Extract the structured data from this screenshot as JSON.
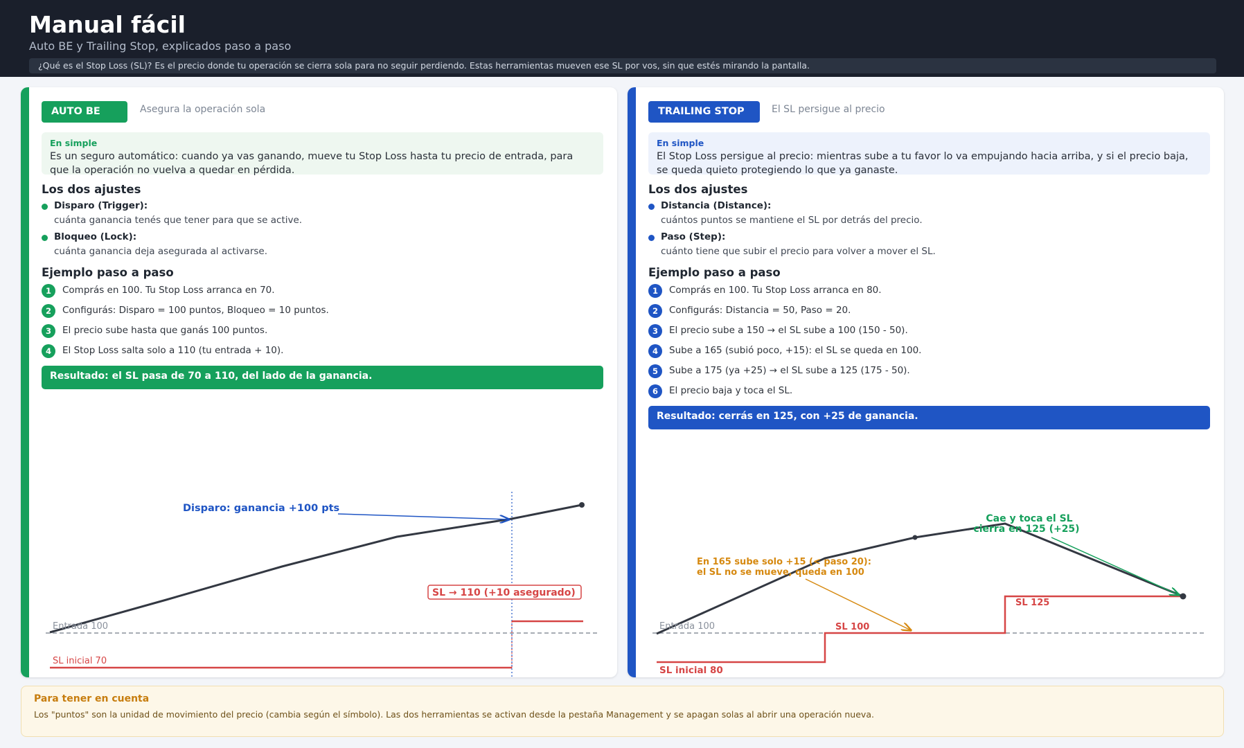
{
  "header": {
    "title": "Manual fácil",
    "subtitle": "Auto BE y Trailing Stop, explicados paso a paso",
    "note": "¿Qué es el Stop Loss (SL)?  Es el precio donde tu operación se cierra sola para no seguir perdiendo. Estas herramientas mueven ese SL por vos, sin que estés mirando la pantalla."
  },
  "colors": {
    "green": "#16a05c",
    "blue": "#1f55c4",
    "red": "#d64545",
    "orange": "#d68910",
    "dark": "#1a1f2b"
  },
  "auto_be": {
    "badge": "AUTO BE",
    "badge_sub": "Asegura la operación sola",
    "simple_label": "En simple",
    "simple_text": "Es un seguro automático: cuando ya vas ganando, mueve tu Stop Loss hasta tu precio de entrada, para que la operación no vuelva a quedar en pérdida.",
    "settings_title": "Los dos ajustes",
    "settings": [
      {
        "name": "Disparo (Trigger):",
        "desc": "cuánta ganancia tenés que tener para que se active."
      },
      {
        "name": "Bloqueo (Lock):",
        "desc": "cuánta ganancia deja asegurada al activarse."
      }
    ],
    "example_title": "Ejemplo paso a paso",
    "steps": [
      {
        "n": "1",
        "text": "Comprás en 100. Tu Stop Loss arranca en 70."
      },
      {
        "n": "2",
        "text": "Configurás: Disparo = 100 puntos, Bloqueo = 10 puntos."
      },
      {
        "n": "3",
        "text": "El precio sube hasta que ganás 100 puntos."
      },
      {
        "n": "4",
        "text": "El Stop Loss salta solo a 110 (tu entrada + 10)."
      }
    ],
    "result": "Resultado: el SL pasa de 70 a 110, del lado de la ganancia.",
    "chart": {
      "trigger_label": "Disparo: ganancia +100 pts",
      "sl_box_label": "SL → 110  (+10 asegurado)",
      "entry_label": "Entrada 100",
      "sl_initial_label": "SL inicial 70"
    }
  },
  "trailing": {
    "badge": "TRAILING STOP",
    "badge_sub": "El SL persigue al precio",
    "simple_label": "En simple",
    "simple_text": "El Stop Loss persigue al precio: mientras sube a tu favor lo va empujando hacia arriba, y si el precio baja, se queda quieto protegiendo lo que ya ganaste.",
    "settings_title": "Los dos ajustes",
    "settings": [
      {
        "name": "Distancia (Distance):",
        "desc": "cuántos puntos se mantiene el SL por detrás del precio."
      },
      {
        "name": "Paso (Step):",
        "desc": "cuánto tiene que subir el precio para volver a mover el SL."
      }
    ],
    "example_title": "Ejemplo paso a paso",
    "steps": [
      {
        "n": "1",
        "text": "Comprás en 100. Tu Stop Loss arranca en 80."
      },
      {
        "n": "2",
        "text": "Configurás: Distancia = 50, Paso = 20."
      },
      {
        "n": "3",
        "text": "El precio sube a 150 → el SL sube a 100 (150 - 50)."
      },
      {
        "n": "4",
        "text": "Sube a 165 (subió poco, +15): el SL se queda en 100."
      },
      {
        "n": "5",
        "text": "Sube a 175 (ya +25) → el SL sube a 125 (175 - 50)."
      },
      {
        "n": "6",
        "text": "El precio baja y toca el SL."
      }
    ],
    "result": "Resultado: cerrás en 125, con +25 de ganancia.",
    "chart": {
      "annot_165_line1": "En 165 sube solo +15 (< paso 20):",
      "annot_165_line2": "el SL no se mueve, queda en 100",
      "annot_hit_line1": "Cae y toca el SL",
      "annot_hit_line2": "cierra en 125  (+25)",
      "sl_125_label": "SL 125",
      "sl_100_label": "SL 100",
      "entry_label": "Entrada 100",
      "sl_initial_label": "SL inicial 80"
    }
  },
  "footer": {
    "title": "Para tener en cuenta",
    "text": "Los \"puntos\" son la unidad de movimiento del precio (cambia según el símbolo). Las dos herramientas se activan desde la pestaña Management y se apagan solas al abrir una operación nueva."
  }
}
